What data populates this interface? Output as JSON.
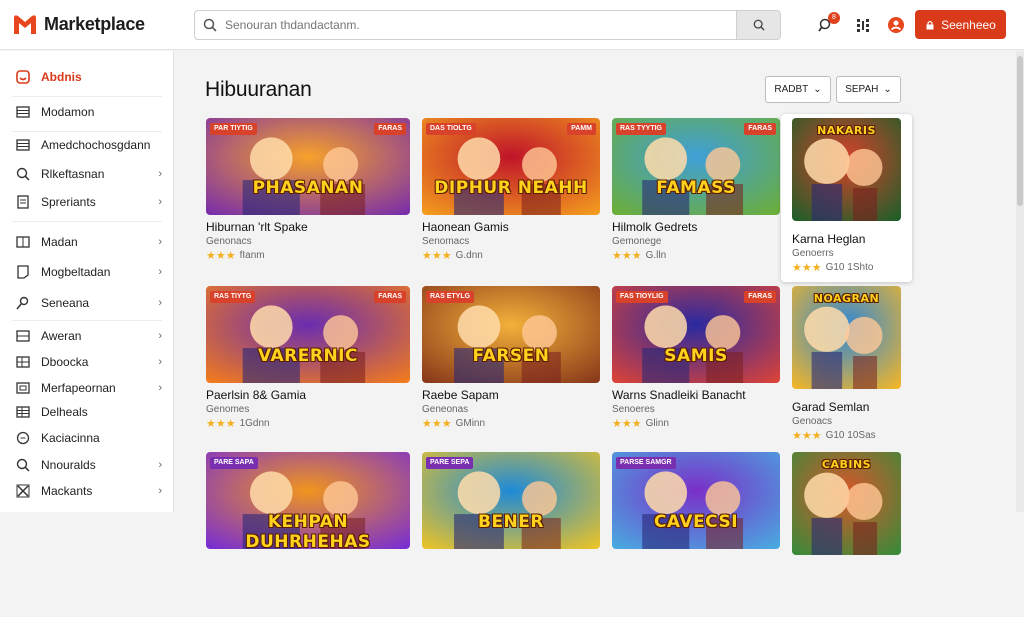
{
  "app": {
    "name": "Marketplace",
    "brand_color": "#d93a1a"
  },
  "header": {
    "search_placeholder": "Senouran thdandactanm.",
    "cta_label": "Seenheeo",
    "notification_badge": "8"
  },
  "sidebar": {
    "items": [
      {
        "label": "Abdnis",
        "icon": "store-icon",
        "active": true,
        "chevron": false
      },
      {
        "label": "Modamon",
        "icon": "list-icon",
        "active": false,
        "chevron": false
      },
      {
        "label": "Amedchochosgdann",
        "icon": "list-icon",
        "active": false,
        "chevron": false
      },
      {
        "label": "Rlkeftasnan",
        "icon": "search-icon",
        "active": false,
        "chevron": true
      },
      {
        "label": "Spreriants",
        "icon": "document-icon",
        "active": false,
        "chevron": true
      },
      {
        "label": "Madan",
        "icon": "book-icon",
        "active": false,
        "chevron": true
      },
      {
        "label": "Mogbeltadan",
        "icon": "tablet-icon",
        "active": false,
        "chevron": true
      },
      {
        "label": "Seneana",
        "icon": "key-icon",
        "active": false,
        "chevron": true
      },
      {
        "label": "Aweran",
        "icon": "grid-icon",
        "active": false,
        "chevron": true
      },
      {
        "label": "Dboocka",
        "icon": "table-icon",
        "active": false,
        "chevron": true
      },
      {
        "label": "Merfapeornan",
        "icon": "folder-icon",
        "active": false,
        "chevron": true
      },
      {
        "label": "Delheals",
        "icon": "table-icon",
        "active": false,
        "chevron": false
      },
      {
        "label": "Kaciacinna",
        "icon": "chat-icon",
        "active": false,
        "chevron": false
      },
      {
        "label": "Nnouralds",
        "icon": "search-icon",
        "active": false,
        "chevron": true
      },
      {
        "label": "Mackants",
        "icon": "tools-icon",
        "active": false,
        "chevron": true
      }
    ]
  },
  "main": {
    "title": "Hibuuranan",
    "filters": [
      {
        "label": "RADBT"
      },
      {
        "label": "SEPAH"
      }
    ]
  },
  "cards": [
    {
      "title": "Hiburnan 'rlt Spake",
      "sub": "Genonacs",
      "stars": "★★★",
      "rating": "fIanm",
      "thumb_text": "PHASANAN",
      "tag_l": "PAR TIYTIG",
      "tag_r": "FARAS",
      "colors": [
        "#f7a12a",
        "#7a2fa8"
      ]
    },
    {
      "title": "Haonean Gamis",
      "sub": "Senomacs",
      "stars": "★★★",
      "rating": "G.dnn",
      "thumb_text": "DIPHUR NEAHH",
      "tag_l": "DAS TIOLTG",
      "tag_r": "PAMM",
      "colors": [
        "#c0142a",
        "#f29a1e"
      ]
    },
    {
      "title": "Hilmolk Gedrets",
      "sub": "Gemonege",
      "stars": "★★★",
      "rating": "G.lln",
      "thumb_text": "FAMASS",
      "tag_l": "RAS TYYTIG",
      "tag_r": "FARAS",
      "colors": [
        "#3f9fd8",
        "#6cae3a"
      ]
    },
    {
      "title": "Karna Heglan",
      "sub": "Genoerrs",
      "stars": "★★★",
      "rating": "G10 1Shto",
      "thumb_text": "NAKARIS",
      "tag_l": "",
      "tag_r": "",
      "colors": [
        "#d8412a",
        "#1f5e2a"
      ]
    },
    {
      "title": "Paerlsin 8& Gamia",
      "sub": "Genomes",
      "stars": "★★★",
      "rating": "1Gdnn",
      "thumb_text": "VARERNIC",
      "tag_l": "RAS TIYTG",
      "tag_r": "FARAS",
      "colors": [
        "#6a2db0",
        "#f07a1e"
      ]
    },
    {
      "title": "Raebe Sapam",
      "sub": "Geneonas",
      "stars": "★★★",
      "rating": "GMinn",
      "thumb_text": "FARSEN",
      "tag_l": "RAS ETYLG",
      "tag_r": "",
      "colors": [
        "#f3b13a",
        "#8a3a1a"
      ]
    },
    {
      "title": "Warns Snadleiki Banacht",
      "sub": "Senoeres",
      "stars": "★★★",
      "rating": "Glinn",
      "thumb_text": "SAMIS",
      "tag_l": "FAS TIOYLIG",
      "tag_r": "FARAS",
      "colors": [
        "#2a2aa0",
        "#d8423a"
      ]
    },
    {
      "title": "Garad Semlan",
      "sub": "Genoacs",
      "stars": "★★★",
      "rating": "G10 10Sas",
      "thumb_text": "NOAGRAN",
      "tag_l": "",
      "tag_r": "",
      "colors": [
        "#2f87d8",
        "#f0b52a"
      ]
    },
    {
      "title": "",
      "sub": "",
      "stars": "",
      "rating": "",
      "thumb_text": "KEHPAN DUHRHEHAS",
      "tag_l": "PARE SAPA",
      "tag_r": "",
      "colors": [
        "#f0951e",
        "#7a2fd0"
      ]
    },
    {
      "title": "",
      "sub": "",
      "stars": "",
      "rating": "",
      "thumb_text": "BENER",
      "tag_l": "PARE SEPA",
      "tag_r": "",
      "colors": [
        "#1e8ad8",
        "#e8c22a"
      ]
    },
    {
      "title": "",
      "sub": "",
      "stars": "",
      "rating": "",
      "thumb_text": "CAVECSI",
      "tag_l": "PARSE SAMGR",
      "tag_r": "",
      "colors": [
        "#7a2fc8",
        "#4aa8e0"
      ]
    },
    {
      "title": "",
      "sub": "",
      "stars": "",
      "rating": "",
      "thumb_text": "CABINS",
      "tag_l": "",
      "tag_r": "",
      "colors": [
        "#d8562a",
        "#3a8a3a"
      ]
    }
  ]
}
